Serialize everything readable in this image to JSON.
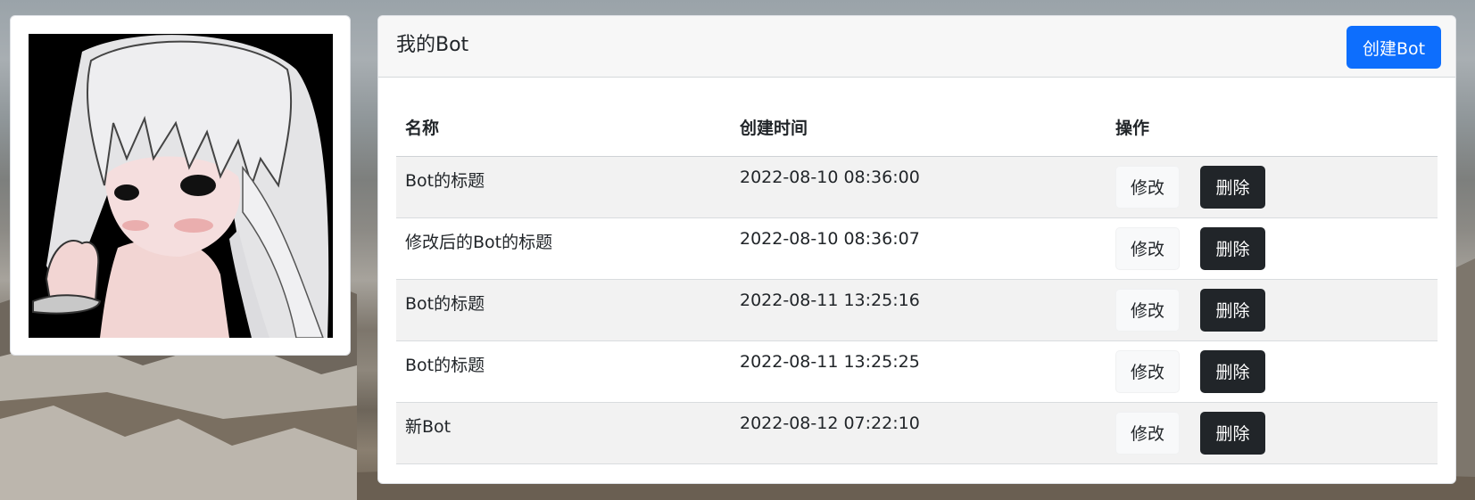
{
  "card": {
    "title": "我的Bot",
    "create_button": "创建Bot"
  },
  "table": {
    "headers": [
      "名称",
      "创建时间",
      "操作"
    ],
    "rows": [
      {
        "name": "Bot的标题",
        "time": "2022-08-10 08:36:00"
      },
      {
        "name": "修改后的Bot的标题",
        "time": "2022-08-10 08:36:07"
      },
      {
        "name": "Bot的标题",
        "time": "2022-08-11 13:25:16"
      },
      {
        "name": "Bot的标题",
        "time": "2022-08-11 13:25:25"
      },
      {
        "name": "新Bot",
        "time": "2022-08-12 07:22:10"
      }
    ],
    "edit_label": "修改",
    "delete_label": "删除"
  },
  "colors": {
    "primary": "#0d6efd",
    "dark": "#212529",
    "light": "#f8f9fa",
    "stripe": "#f2f2f2"
  }
}
